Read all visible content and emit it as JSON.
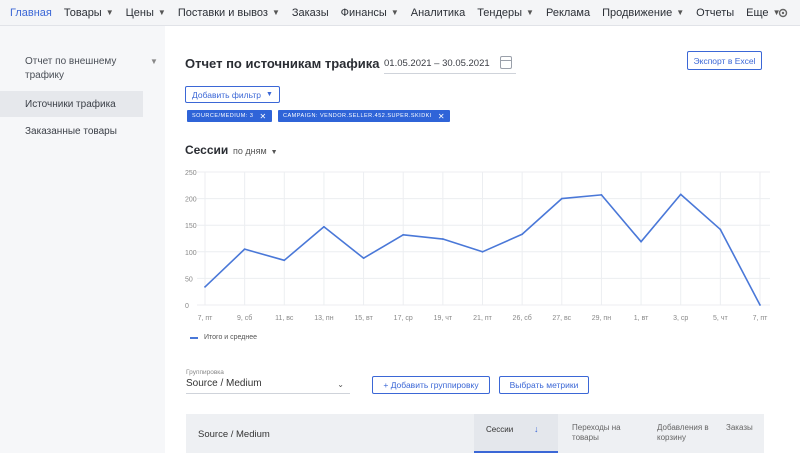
{
  "nav": {
    "items": [
      {
        "label": "Главная",
        "active": true,
        "has_chevron": false
      },
      {
        "label": "Товары",
        "active": false,
        "has_chevron": true
      },
      {
        "label": "Цены",
        "active": false,
        "has_chevron": true
      },
      {
        "label": "Поставки и вывоз",
        "active": false,
        "has_chevron": true
      },
      {
        "label": "Заказы",
        "active": false,
        "has_chevron": false
      },
      {
        "label": "Финансы",
        "active": false,
        "has_chevron": true
      },
      {
        "label": "Аналитика",
        "active": false,
        "has_chevron": false
      },
      {
        "label": "Тендеры",
        "active": false,
        "has_chevron": true
      },
      {
        "label": "Реклама",
        "active": false,
        "has_chevron": false
      },
      {
        "label": "Продвижение",
        "active": false,
        "has_chevron": true
      },
      {
        "label": "Отчеты",
        "active": false,
        "has_chevron": false
      },
      {
        "label": "Еще",
        "active": false,
        "has_chevron": true
      }
    ],
    "settings_icon": "gear-icon"
  },
  "sidebar": {
    "group_label": "Отчет по внешнему трафику",
    "items": [
      {
        "label": "Источники трафика",
        "active": true
      },
      {
        "label": "Заказанные товары",
        "active": false
      }
    ]
  },
  "header": {
    "title": "Отчет по источникам трафика",
    "date_range": "01.05.2021 – 30.05.2021",
    "export_label": "Экспорт в Excel",
    "add_filter_label": "Добавить фильтр"
  },
  "filters": [
    {
      "label": "SOURCE/MEDIUM: 3"
    },
    {
      "label": "CAMPAIGN: VENDOR.SELLER.452.SUPER.SKIDKI"
    }
  ],
  "sessions": {
    "title": "Сессии",
    "period": "по дням"
  },
  "chart_data": {
    "type": "line",
    "categories": [
      "7, пт",
      "9, сб",
      "11, вс",
      "13, пн",
      "15, вт",
      "17, ср",
      "19, чт",
      "21, пт",
      "26, сб",
      "27, вс",
      "29, пн",
      "1, вт",
      "3, ср",
      "5, чт",
      "7, пт"
    ],
    "series": [
      {
        "name": "Итого и среднее",
        "values": [
          34,
          105,
          84,
          147,
          88,
          132,
          124,
          100,
          133,
          200,
          207,
          119,
          208,
          142,
          0
        ]
      }
    ],
    "yticks": [
      0,
      50,
      100,
      150,
      200,
      250
    ],
    "ylim": [
      0,
      250
    ],
    "grid": true,
    "color": "#4a78d8",
    "legend": "bottom-left"
  },
  "grouping": {
    "label": "Группировка",
    "value": "Source / Medium",
    "add_group_label": "+ Добавить группировку",
    "metrics_label": "Выбрать метрики"
  },
  "table": {
    "columns": [
      "Source / Medium",
      "Сессии",
      "Переходы на товары",
      "Добавления в корзину",
      "Заказы"
    ]
  }
}
